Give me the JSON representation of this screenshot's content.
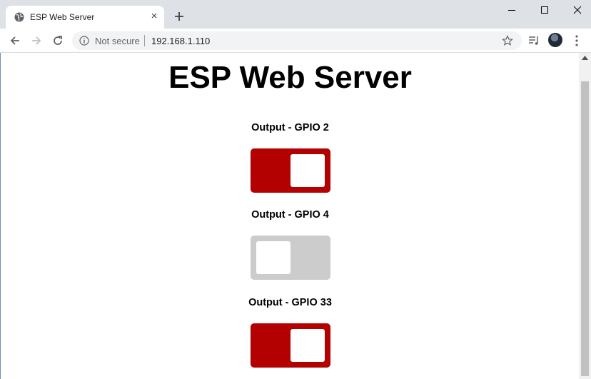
{
  "browser": {
    "tab_title": "ESP Web Server",
    "tab_close": "×",
    "security_label": "Not secure",
    "url": "192.168.1.110"
  },
  "page": {
    "title": "ESP Web Server",
    "outputs": [
      {
        "label": "Output - GPIO 2",
        "state": "on"
      },
      {
        "label": "Output - GPIO 4",
        "state": "off"
      },
      {
        "label": "Output - GPIO 33",
        "state": "on"
      }
    ]
  },
  "colors": {
    "switch_on": "#b30000",
    "switch_off": "#cccccc",
    "tabstrip": "#dee1e6"
  }
}
